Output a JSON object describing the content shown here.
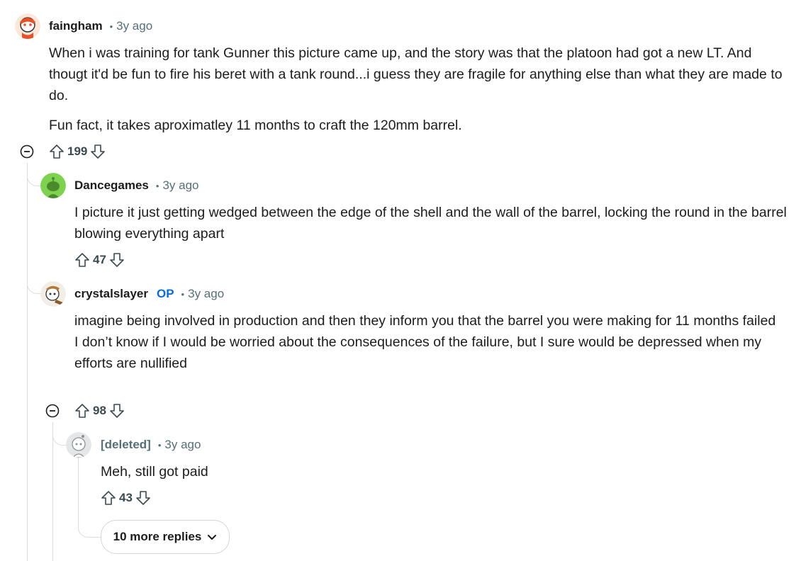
{
  "comments": [
    {
      "username": "faingham",
      "time": "3y ago",
      "avatar_color": "#e8502a",
      "paragraphs": [
        "When i was training for tank Gunner this picture came up, and the story was that the platoon had got a new LT. And thougt it'd be fun to fire his beret with a tank round...i guess they are fragile for anything else than what they are made to do.",
        "Fun fact, it takes aproximatley 11 months to craft the 120mm barrel."
      ],
      "votes": "199"
    },
    {
      "username": "Dancegames",
      "time": "3y ago",
      "avatar_color": "#7dd34f",
      "paragraphs": [
        "I picture it just getting wedged between the edge of the shell and the wall of the barrel, locking the round in the barrel blowing everything apart"
      ],
      "votes": "47"
    },
    {
      "username": "crystalslayer",
      "op_badge": "OP",
      "time": "3y ago",
      "avatar_color": "#f2ede6",
      "paragraphs": [
        "imagine being involved in production and then they inform you that the barrel you were making for 11 months failed",
        "I don’t know if I would be worried about the consequences of the failure, but I sure would be depressed when my efforts are nullified"
      ],
      "votes": "98"
    },
    {
      "username": "[deleted]",
      "time": "3y ago",
      "avatar_color": "#e4e7e9",
      "paragraphs": [
        "Meh, still got paid"
      ],
      "votes": "43"
    }
  ],
  "more_replies": {
    "label": "10 more replies"
  },
  "separator": "•",
  "icons": {
    "upvote": "upvote-arrow-icon",
    "downvote": "downvote-arrow-icon",
    "collapse": "collapse-minus-icon",
    "chevron": "chevron-down-icon"
  }
}
